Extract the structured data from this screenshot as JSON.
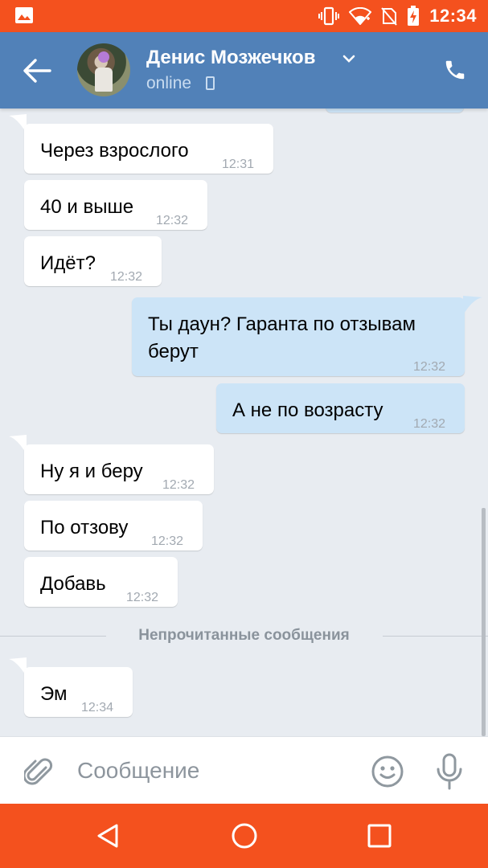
{
  "status_bar": {
    "time": "12:34",
    "icons": [
      "image-notification-icon",
      "vibrate-icon",
      "wifi-icon",
      "no-sim-icon",
      "battery-charging-icon"
    ]
  },
  "header": {
    "contact_name": "Денис Мозжечков",
    "status": "online",
    "icons": [
      "back-arrow-icon",
      "chevron-down-icon",
      "mobile-device-icon",
      "phone-call-icon"
    ]
  },
  "messages": [
    {
      "direction": "in",
      "text": "Через взрослого",
      "time": "12:31"
    },
    {
      "direction": "in",
      "text": "40 и выше",
      "time": "12:32"
    },
    {
      "direction": "in",
      "text": "Идёт?",
      "time": "12:32"
    },
    {
      "direction": "out",
      "text_line1": "Ты даун? Гаранта по отзывам",
      "text_line2": "берут",
      "time": "12:32"
    },
    {
      "direction": "out",
      "text": "А не по возрасту",
      "time": "12:32"
    },
    {
      "direction": "in",
      "text": "Ну я и беру",
      "time": "12:32"
    },
    {
      "direction": "in",
      "text": "По отзову",
      "time": "12:32"
    },
    {
      "direction": "in",
      "text": "Добавь",
      "time": "12:32"
    },
    {
      "direction": "in",
      "text": "Эм",
      "time": "12:34"
    }
  ],
  "unread_divider": "Непрочитанные сообщения",
  "composer": {
    "placeholder": "Сообщение",
    "value": "",
    "icons": [
      "paperclip-icon",
      "smiley-icon",
      "microphone-icon"
    ]
  },
  "colors": {
    "status_bar": "#f4511e",
    "header": "#5181b8",
    "background": "#e8ecf1",
    "incoming_bubble": "#ffffff",
    "outgoing_bubble": "#cce4f7",
    "nav_bar": "#f4511e"
  },
  "nav_bar": {
    "icons": [
      "back-triangle-icon",
      "home-circle-icon",
      "recents-square-icon"
    ]
  }
}
